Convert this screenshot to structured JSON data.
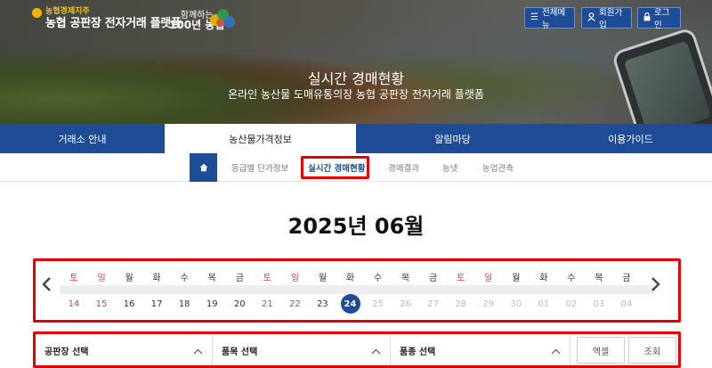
{
  "header": {
    "logo_small": "농협경제지주",
    "logo_main": "농협 공판장 전자거래 플랫폼",
    "slogan_line1": "함께하는",
    "slogan_line2": "100년 농협",
    "buttons": [
      {
        "label": "전체메뉴",
        "icon": "hamburger-menu-icon"
      },
      {
        "label": "회원가입",
        "icon": "user-icon"
      },
      {
        "label": "로그인",
        "icon": "lock-icon"
      }
    ]
  },
  "hero": {
    "title": "실시간 경매현황",
    "subtitle": "온라인 농산물 도매유통의장 농협 공판장 전자거래 플랫폼"
  },
  "main_nav": [
    {
      "label": "거래소 안내",
      "active": false
    },
    {
      "label": "농산물가격정보",
      "active": true
    },
    {
      "label": "알림마당",
      "active": false
    },
    {
      "label": "이용가이드",
      "active": false
    }
  ],
  "sub_nav": [
    {
      "label": "등급별 단가정보",
      "active": false
    },
    {
      "label": "실시간 경매현황",
      "active": true
    },
    {
      "label": "경매결과",
      "active": false
    },
    {
      "label": "농넷",
      "active": false
    },
    {
      "label": "농업관측",
      "active": false
    }
  ],
  "month_title": "2025년 06월",
  "calendar": {
    "prev_icon": "chevron-left-icon",
    "next_icon": "chevron-right-icon",
    "weekdays": [
      "토",
      "일",
      "월",
      "화",
      "수",
      "목",
      "금",
      "토",
      "일",
      "월",
      "화",
      "수",
      "목",
      "금",
      "토",
      "일",
      "월",
      "화",
      "수",
      "목",
      "금"
    ],
    "days": [
      {
        "d": "14",
        "type": "red"
      },
      {
        "d": "15",
        "type": "red"
      },
      {
        "d": "16",
        "type": "normal"
      },
      {
        "d": "17",
        "type": "normal"
      },
      {
        "d": "18",
        "type": "normal"
      },
      {
        "d": "19",
        "type": "normal"
      },
      {
        "d": "20",
        "type": "normal"
      },
      {
        "d": "21",
        "type": "red"
      },
      {
        "d": "22",
        "type": "red"
      },
      {
        "d": "23",
        "type": "normal"
      },
      {
        "d": "24",
        "type": "today"
      },
      {
        "d": "25",
        "type": "gray"
      },
      {
        "d": "26",
        "type": "gray"
      },
      {
        "d": "27",
        "type": "gray"
      },
      {
        "d": "28",
        "type": "gray"
      },
      {
        "d": "29",
        "type": "gray"
      },
      {
        "d": "30",
        "type": "gray"
      },
      {
        "d": "01",
        "type": "gray"
      },
      {
        "d": "02",
        "type": "gray"
      },
      {
        "d": "03",
        "type": "gray"
      },
      {
        "d": "04",
        "type": "gray"
      }
    ]
  },
  "filters": {
    "market_select": "공판장 선택",
    "item_select": "품목 선택",
    "variety_select": "품종 선택",
    "excel_button": "엑셀",
    "search_button": "조회"
  },
  "colors": {
    "primary": "#1e4c97",
    "highlight_box": "#e50000",
    "weekend": "#e33a3a",
    "future_day": "#bdbdbd"
  }
}
